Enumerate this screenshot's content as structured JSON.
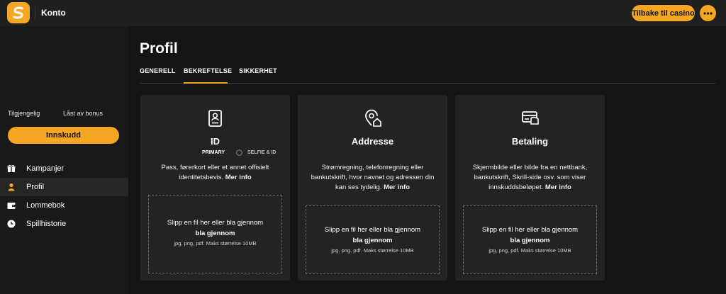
{
  "header": {
    "title": "Konto",
    "back_button": "Tilbake til casino",
    "colors": {
      "accent": "#f5a623",
      "bar": "#1f1f1f"
    }
  },
  "sidebar": {
    "available_label": "Tilgjengelig",
    "locked_label": "Låst av bonus",
    "deposit_button": "Innskudd",
    "items": [
      {
        "label": "Kampanjer",
        "icon": "gift-icon"
      },
      {
        "label": "Profil",
        "icon": "user-icon",
        "active": true
      },
      {
        "label": "Lommebok",
        "icon": "wallet-icon"
      },
      {
        "label": "Spillhistorie",
        "icon": "clock-icon"
      }
    ]
  },
  "main": {
    "title": "Profil",
    "tabs": [
      {
        "label": "GENERELL"
      },
      {
        "label": "BEKREFTELSE",
        "active": true
      },
      {
        "label": "SIKKERHET"
      }
    ]
  },
  "cards": [
    {
      "title": "ID",
      "icon": "id-card-icon",
      "subtab_primary": "PRIMARY",
      "subtab_secondary": "SELFIE & ID",
      "desc": "Pass, førerkort eller et annet offisielt identitetsbevis.",
      "more": "Mer info",
      "drop_line1": "Slipp en fil her eller bla gjennom",
      "drop_line2": "bla gjennom",
      "drop_line3": "jpg, png, pdf. Maks størrelse 10MB"
    },
    {
      "title": "Addresse",
      "icon": "location-home-icon",
      "desc": "Strømregning, telefonregning eller bankutskrift, hvor navnet og adressen din kan ses tydelig.",
      "more": "Mer info",
      "drop_line1": "Slipp en fil her eller bla gjennom",
      "drop_line2": "bla gjennom",
      "drop_line3": "jpg, png, pdf. Maks størrelse 10MB"
    },
    {
      "title": "Betaling",
      "icon": "payment-card-icon",
      "desc": "Skjermbilde eller bilde fra en nettbank, bankutskrift, Skrill-side osv. som viser innskuddsbeløpet.",
      "more": "Mer info",
      "drop_line1": "Slipp en fil her eller bla gjennom",
      "drop_line2": "bla gjennom",
      "drop_line3": "jpg, png, pdf. Maks størrelse 10MB"
    }
  ]
}
